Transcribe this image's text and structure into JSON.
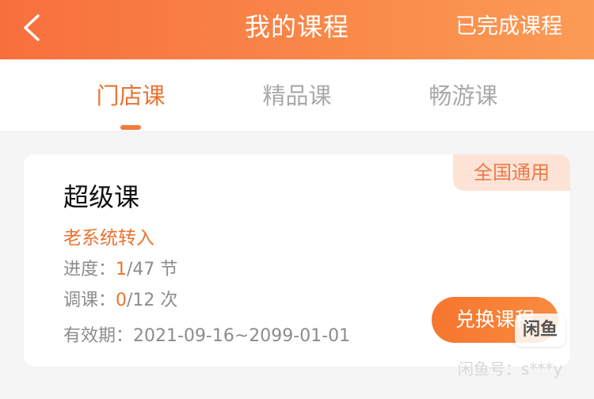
{
  "header": {
    "title": "我的课程",
    "completed_link": "已完成课程",
    "background_gradient": [
      "#f86f3d",
      "#fb9b56"
    ]
  },
  "tabs": [
    {
      "label": "门店课",
      "active": true
    },
    {
      "label": "精品课",
      "active": false
    },
    {
      "label": "畅游课",
      "active": false
    }
  ],
  "course_card": {
    "scope_badge": "全国通用",
    "name": "超级课",
    "source": "老系统转入",
    "progress": {
      "label": "进度：",
      "current": "1",
      "total": "/47 节"
    },
    "reschedule": {
      "label": "调课：",
      "current": "0",
      "total": "/12 次"
    },
    "validity": {
      "label": "有效期：",
      "value": "2021-09-16~2099-01-01"
    },
    "exchange_button": "兑换课程"
  },
  "watermark": {
    "logo_text": "闲鱼",
    "id_text": "闲鱼号：s***y"
  },
  "colors": {
    "accent": "#e9732f",
    "badge_bg": "#fde3d6",
    "page_bg": "#f5f5f5"
  }
}
